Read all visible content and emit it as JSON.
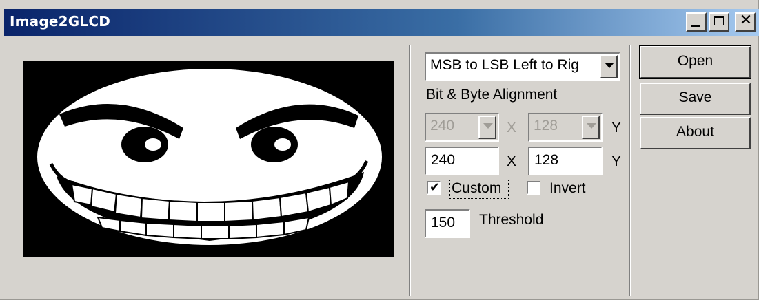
{
  "window": {
    "title": "Image2GLCD"
  },
  "window_controls": {
    "minimize": "minimize",
    "maximize": "maximize",
    "close": "close"
  },
  "settings": {
    "scan_mode": "MSB to LSB Left to Rig",
    "scan_mode_caption": "Bit & Byte Alignment",
    "preset_width": "240",
    "preset_height": "128",
    "custom_width": "240",
    "custom_height": "128",
    "x_label": "X",
    "y_label": "Y",
    "custom_label": "Custom",
    "custom_checked": true,
    "invert_label": "Invert",
    "invert_checked": false,
    "threshold_value": "150",
    "threshold_label": "Threshold"
  },
  "buttons": {
    "open": "Open",
    "save": "Save",
    "about": "About"
  },
  "icons": {
    "dropdown": "chevron-down-icon",
    "check": "checkmark-icon"
  },
  "colors": {
    "title_start": "#0a246a",
    "title_end": "#a6caf0",
    "face": "#d6d3ce",
    "preview_bg": "#000000"
  }
}
